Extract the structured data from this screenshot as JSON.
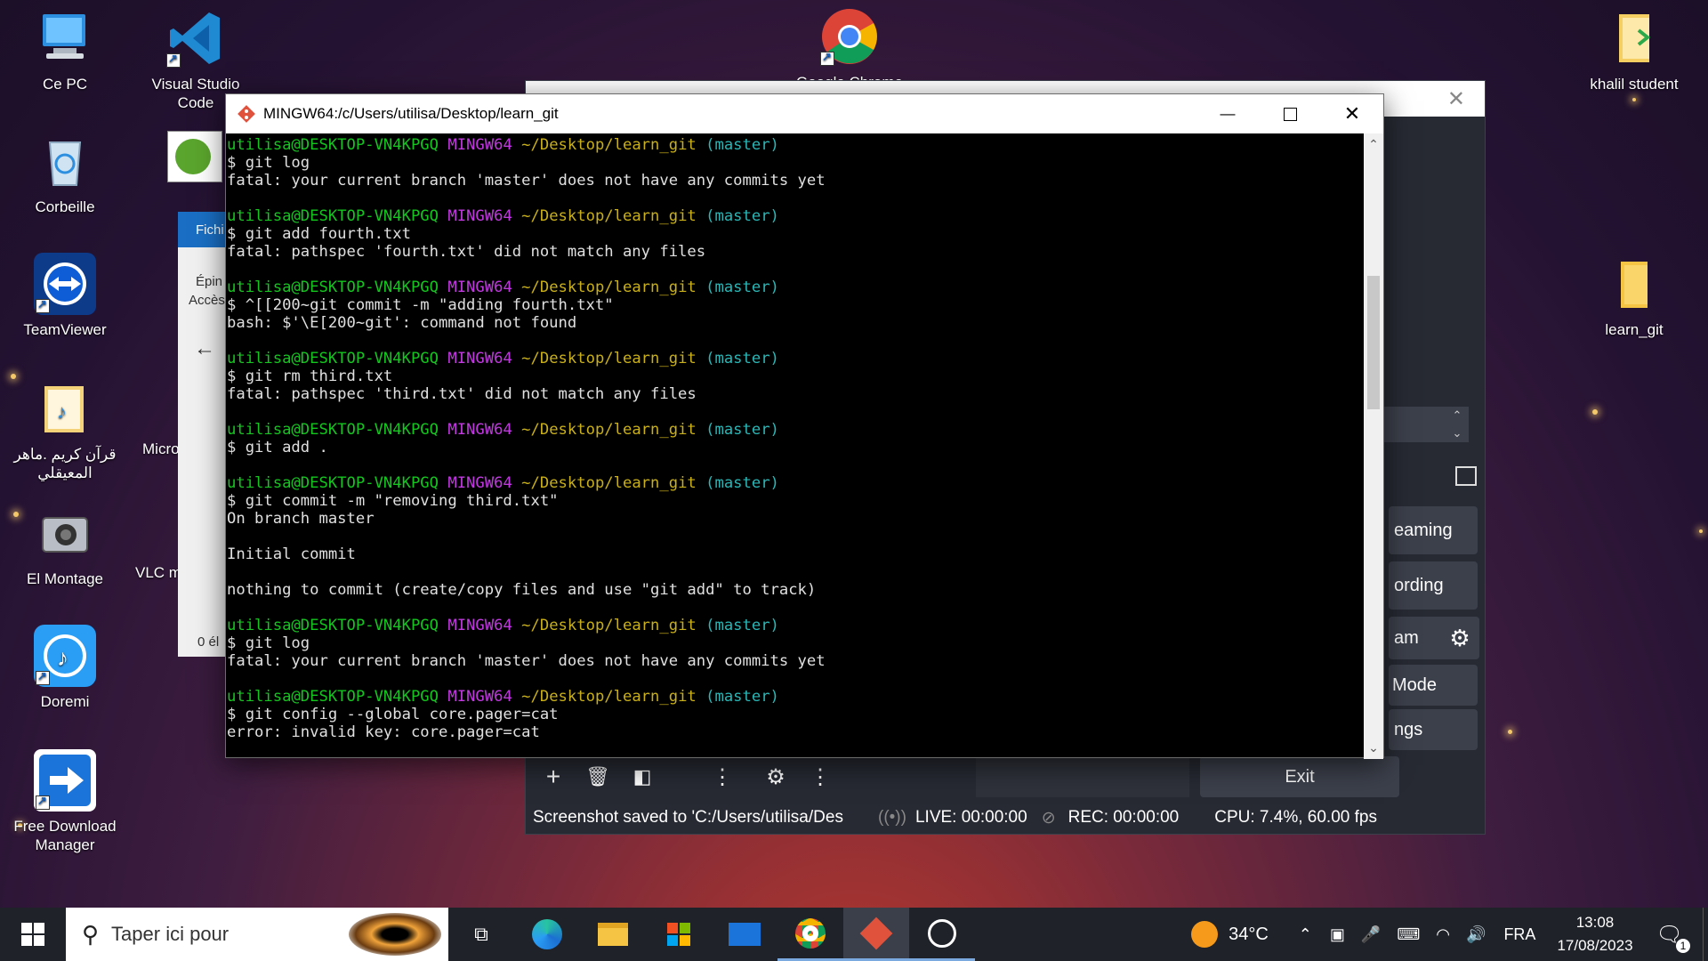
{
  "desktop": {
    "icons_left": [
      {
        "label": "Ce PC"
      },
      {
        "label": "Corbeille"
      },
      {
        "label": "TeamViewer"
      },
      {
        "label": "قرآن كريم .ماهر المعيقلي"
      },
      {
        "label": "El Montage"
      },
      {
        "label": "Doremi"
      },
      {
        "label": "Free Download Manager"
      }
    ],
    "icons_col2": [
      {
        "label": "Visual Studio Code"
      },
      {
        "label": "Micro"
      },
      {
        "label": "VLC m"
      }
    ],
    "icons_top": [
      {
        "label": "Google Chrome"
      }
    ],
    "icons_right": [
      {
        "label": "khalil student"
      },
      {
        "label": "learn_git"
      }
    ]
  },
  "explorer_partial": {
    "tab": "Fichi",
    "pin_text": "Épin",
    "access_text": "Accès",
    "status": "0 él"
  },
  "terminal": {
    "title": "MINGW64:/c/Users/utilisa/Desktop/learn_git",
    "prompt_user": "utilisa@DESKTOP-VN4KPGQ",
    "prompt_env": "MINGW64",
    "prompt_path": "~/Desktop/learn_git",
    "prompt_branch": "(master)",
    "blocks": [
      {
        "command": "$ git log",
        "output": [
          "fatal: your current branch 'master' does not have any commits yet"
        ]
      },
      {
        "command": "$ git add fourth.txt",
        "output": [
          "fatal: pathspec 'fourth.txt' did not match any files"
        ]
      },
      {
        "command": "$ ^[[200~git commit -m \"adding fourth.txt\"",
        "output": [
          "bash: $'\\E[200~git': command not found"
        ]
      },
      {
        "command": "$ git rm third.txt",
        "output": [
          "fatal: pathspec 'third.txt' did not match any files"
        ]
      },
      {
        "command": "$ git add .",
        "output": []
      },
      {
        "command": "$ git commit -m \"removing third.txt\"",
        "output": [
          "On branch master",
          "",
          "Initial commit",
          "",
          "nothing to commit (create/copy files and use \"git add\" to track)"
        ]
      },
      {
        "command": "$ git log",
        "output": [
          "fatal: your current branch 'master' does not have any commits yet"
        ]
      },
      {
        "command": "$ git config --global core.pager=cat",
        "output": [
          "error: invalid key: core.pager=cat"
        ]
      }
    ]
  },
  "obs": {
    "buttons_partial": [
      "eaming",
      "ording",
      "am",
      "Mode",
      "ngs"
    ],
    "exit_label": "Exit",
    "status": {
      "screenshot": "Screenshot saved to 'C:/Users/utilisa/Des",
      "live": "LIVE: 00:00:00",
      "rec": "REC: 00:00:00",
      "cpu": "CPU: 7.4%, 60.00 fps"
    }
  },
  "taskbar": {
    "search_placeholder": "Taper ici pour",
    "weather": "34°C",
    "language": "FRA",
    "time": "13:08",
    "date": "17/08/2023",
    "notifications_count": "1"
  }
}
